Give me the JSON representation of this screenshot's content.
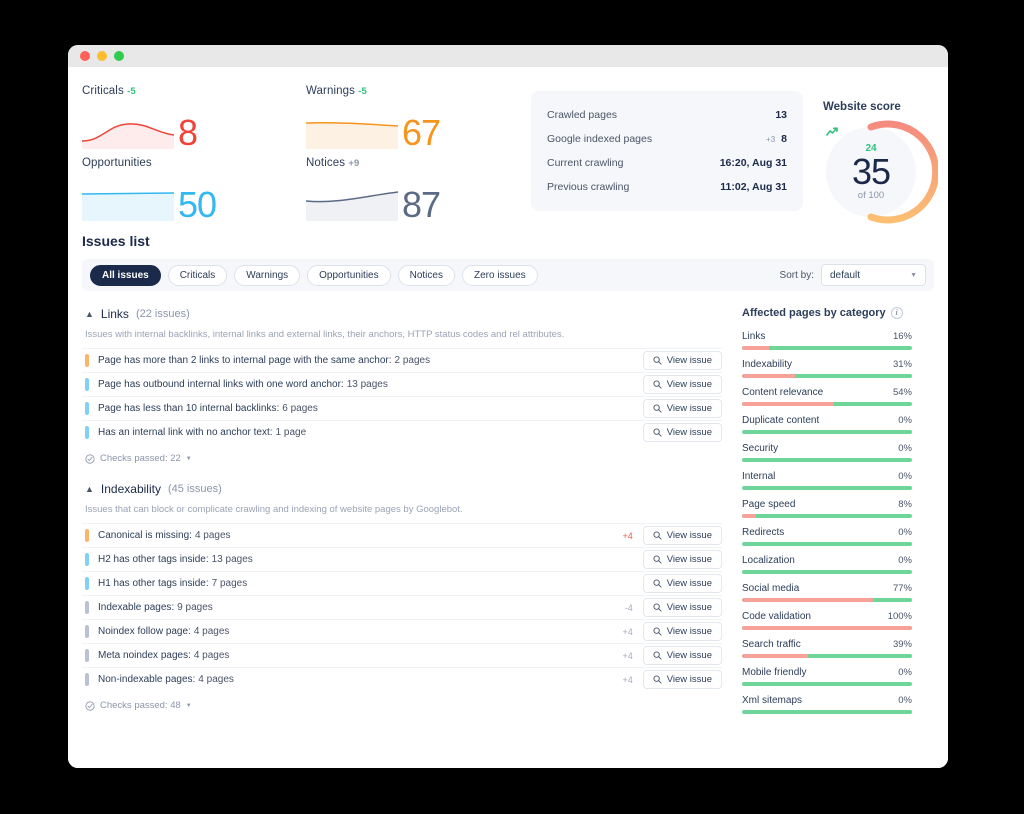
{
  "window": {
    "traffic_lights": [
      "close",
      "minimize",
      "maximize"
    ]
  },
  "metrics": [
    {
      "label": "Criticals",
      "delta": "-5",
      "delta_dir": "down",
      "value": "8",
      "color": "#f04438",
      "fill": "#fdeceb",
      "spark": "hump"
    },
    {
      "label": "Opportunities",
      "delta": "",
      "delta_dir": "none",
      "value": "50",
      "color": "#33b8f0",
      "fill": "#e7f6fd",
      "spark": "flat"
    },
    {
      "label": "Warnings",
      "delta": "-5",
      "delta_dir": "down",
      "value": "67",
      "color": "#f7941d",
      "fill": "#fdf1e3",
      "spark": "flat"
    },
    {
      "label": "Notices",
      "delta": "+9",
      "delta_dir": "note",
      "value": "87",
      "color": "#5c6b85",
      "fill": "#f0f1f5",
      "spark": "rise"
    }
  ],
  "stats": {
    "rows": [
      {
        "label": "Crawled pages",
        "delta": "",
        "value": "13"
      },
      {
        "label": "Google indexed pages",
        "delta": "+3",
        "value": "8"
      },
      {
        "label": "Current crawling",
        "delta": "",
        "value": "16:20, Aug 31"
      },
      {
        "label": "Previous crawling",
        "delta": "",
        "value": "11:02, Aug 31"
      }
    ]
  },
  "score": {
    "title": "Website score",
    "trend": "24",
    "trend_icon": "trend-up-icon",
    "value": "35",
    "of": "of 100",
    "percent": 35,
    "arc_color_start": "#f48b7f",
    "arc_color_end": "#fbbf73"
  },
  "issues": {
    "title": "Issues list",
    "chips": [
      {
        "label": "All issues",
        "active": true
      },
      {
        "label": "Criticals",
        "active": false
      },
      {
        "label": "Warnings",
        "active": false
      },
      {
        "label": "Opportunities",
        "active": false
      },
      {
        "label": "Notices",
        "active": false
      },
      {
        "label": "Zero issues",
        "active": false
      }
    ],
    "sort_label": "Sort by:",
    "sort_value": "default",
    "sort_options": [
      "default"
    ],
    "view_issue_label": "View issue",
    "sections": [
      {
        "name": "Links",
        "count": "(22 issues)",
        "desc": "Issues with internal backlinks, internal links and external links, their anchors, HTTP status codes and rel attributes.",
        "rows": [
          {
            "severity": "warning",
            "text": "Page has more than 2 links to internal page with the same anchor:",
            "count": "2 pages",
            "delta": "",
            "delta_kind": ""
          },
          {
            "severity": "opportunity",
            "text": "Page has outbound internal links with one word anchor:",
            "count": "13 pages",
            "delta": "",
            "delta_kind": ""
          },
          {
            "severity": "opportunity",
            "text": "Page has less than 10 internal backlinks:",
            "count": "6 pages",
            "delta": "",
            "delta_kind": ""
          },
          {
            "severity": "opportunity",
            "text": "Has an internal link with no anchor text:",
            "count": "1 page",
            "delta": "",
            "delta_kind": ""
          }
        ],
        "checks_passed": "Checks passed: 22"
      },
      {
        "name": "Indexability",
        "count": "(45 issues)",
        "desc": "Issues that can block or complicate crawling and indexing of website pages by Googlebot.",
        "rows": [
          {
            "severity": "warning",
            "text": "Canonical is missing:",
            "count": "4 pages",
            "delta": "+4",
            "delta_kind": "red"
          },
          {
            "severity": "opportunity",
            "text": "H2 has other tags inside:",
            "count": "13 pages",
            "delta": "",
            "delta_kind": ""
          },
          {
            "severity": "opportunity",
            "text": "H1 has other tags inside:",
            "count": "7 pages",
            "delta": "",
            "delta_kind": ""
          },
          {
            "severity": "notice",
            "text": "Indexable pages:",
            "count": "9 pages",
            "delta": "-4",
            "delta_kind": "gray"
          },
          {
            "severity": "notice",
            "text": "Noindex follow page:",
            "count": "4 pages",
            "delta": "+4",
            "delta_kind": "gray"
          },
          {
            "severity": "notice",
            "text": "Meta noindex pages:",
            "count": "4 pages",
            "delta": "+4",
            "delta_kind": "gray"
          },
          {
            "severity": "notice",
            "text": "Non-indexable pages:",
            "count": "4 pages",
            "delta": "+4",
            "delta_kind": "gray"
          }
        ],
        "checks_passed": "Checks passed: 48"
      }
    ]
  },
  "categories": {
    "title": "Affected pages by category",
    "items": [
      {
        "label": "Links",
        "pct": "16%",
        "value": 16
      },
      {
        "label": "Indexability",
        "pct": "31%",
        "value": 31
      },
      {
        "label": "Content relevance",
        "pct": "54%",
        "value": 54
      },
      {
        "label": "Duplicate content",
        "pct": "0%",
        "value": 0
      },
      {
        "label": "Security",
        "pct": "0%",
        "value": 0
      },
      {
        "label": "Internal",
        "pct": "0%",
        "value": 0
      },
      {
        "label": "Page speed",
        "pct": "8%",
        "value": 8
      },
      {
        "label": "Redirects",
        "pct": "0%",
        "value": 0
      },
      {
        "label": "Localization",
        "pct": "0%",
        "value": 0
      },
      {
        "label": "Social media",
        "pct": "77%",
        "value": 77
      },
      {
        "label": "Code validation",
        "pct": "100%",
        "value": 100
      },
      {
        "label": "Search traffic",
        "pct": "39%",
        "value": 39
      },
      {
        "label": "Mobile friendly",
        "pct": "0%",
        "value": 0
      },
      {
        "label": "Xml sitemaps",
        "pct": "0%",
        "value": 0
      }
    ],
    "bar_affected_color": "#f7a199",
    "bar_ok_color": "#6fd69a"
  }
}
